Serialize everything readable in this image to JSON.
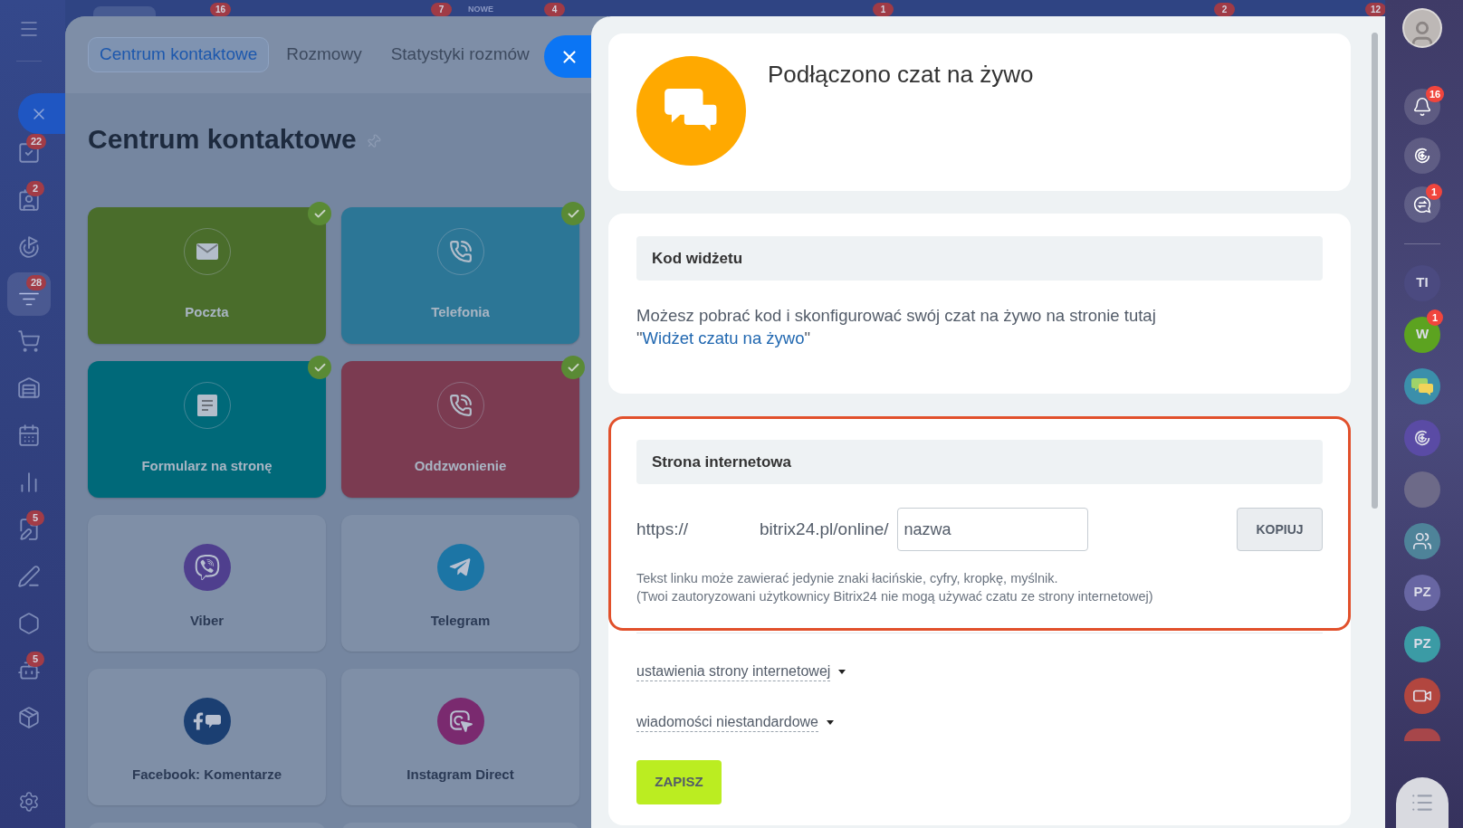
{
  "top_bar": {
    "badges": [
      {
        "kind": "count",
        "text": "16"
      },
      {
        "kind": "count",
        "text": "7"
      },
      {
        "kind": "label",
        "text": "NOWE"
      },
      {
        "kind": "count",
        "text": "4"
      },
      {
        "kind": "count",
        "text": "1"
      },
      {
        "kind": "count",
        "text": "2"
      },
      {
        "kind": "count",
        "text": "12"
      }
    ]
  },
  "left_sidebar": {
    "items": [
      {
        "selected": false,
        "badge": "22"
      },
      {
        "selected": false,
        "badge": "2"
      },
      {
        "selected": false
      },
      {
        "selected": true,
        "badge": "28"
      },
      {
        "selected": false
      },
      {
        "selected": false
      },
      {
        "selected": false
      },
      {
        "selected": false
      },
      {
        "selected": false,
        "badge": "5"
      },
      {
        "selected": false
      },
      {
        "selected": false
      },
      {
        "selected": false,
        "badge": "5"
      },
      {
        "selected": false
      }
    ]
  },
  "channels_panel": {
    "tabs": [
      {
        "label": "Centrum kontaktowe",
        "selected": true
      },
      {
        "label": "Rozmowy",
        "selected": false
      },
      {
        "label": "Statystyki rozmów",
        "selected": false
      }
    ],
    "title": "Centrum kontaktowe",
    "tiles": [
      {
        "label": "Poczta",
        "connected": true,
        "color": "#4a6d2b"
      },
      {
        "label": "Telefonia",
        "connected": true,
        "color": "#2c7696"
      },
      {
        "label": "Formularz na stronę",
        "connected": true,
        "color": "#006979"
      },
      {
        "label": "Oddzwonienie",
        "connected": true,
        "color": "#7b3b51"
      },
      {
        "label": "Viber",
        "connected": false,
        "color": "#4f3f8e"
      },
      {
        "label": "Telegram",
        "connected": false,
        "color": "#1c75a5"
      },
      {
        "label": "Facebook: Komentarze",
        "connected": false,
        "color": "#1b3f72"
      },
      {
        "label": "Instagram Direct",
        "connected": false,
        "color": "#7a2a6f"
      }
    ]
  },
  "settings_panel": {
    "header": {
      "title": "Podłączono czat na żywo"
    },
    "widget_code": {
      "heading": "Kod widżetu",
      "text_before": "Możesz pobrać kod i skonfigurować swój czat na żywo na stronie tutaj \"",
      "link": "Widżet czatu na żywo",
      "text_after": "\""
    },
    "website": {
      "heading": "Strona internetowa",
      "prefix": "https://",
      "domain": "bitrix24.pl/online/",
      "input": {
        "value": "nazwa"
      },
      "copy_button": "KOPIUJ",
      "hints": [
        "Tekst linku może zawierać jedynie znaki łacińskie, cyfry, kropkę, myślnik.",
        "(Twoi zautoryzowani użytkownicy Bitrix24 nie mogą używać czatu ze strony internetowej)"
      ]
    },
    "toggles": [
      {
        "label": "ustawienia strony internetowej",
        "expanded": false
      },
      {
        "label": "wiadomości niestandardowe",
        "expanded": false
      }
    ],
    "save_button": "ZAPISZ"
  },
  "right_sidebar": {
    "top": [
      {
        "kind": "avatar"
      },
      {
        "kind": "button",
        "badge": "16"
      },
      {
        "kind": "button"
      },
      {
        "kind": "button",
        "badge": "1"
      }
    ],
    "chats": [
      {
        "kind": "initials",
        "text": "TI",
        "color": "#4b4a80"
      },
      {
        "kind": "initials",
        "text": "W",
        "color": "#5ca320",
        "badge": "1"
      },
      {
        "kind": "icon",
        "color": "#3b8fab"
      },
      {
        "kind": "icon",
        "color": "#5a4ba5"
      },
      {
        "kind": "photo"
      },
      {
        "kind": "icon",
        "color": "#4e8399"
      },
      {
        "kind": "initials",
        "text": "PZ",
        "color": "#6866a3"
      },
      {
        "kind": "initials",
        "text": "PZ",
        "color": "#3b9ba5"
      },
      {
        "kind": "icon",
        "color": "#b2463f"
      },
      {
        "kind": "partial",
        "color": "#a7464a"
      }
    ]
  }
}
